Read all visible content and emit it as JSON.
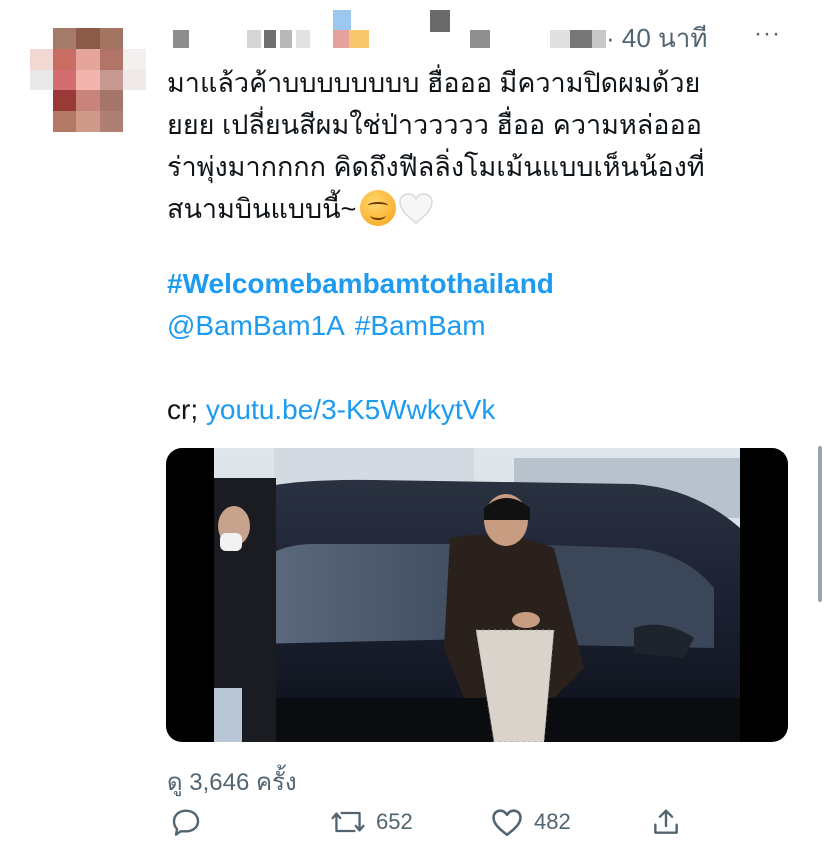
{
  "header": {
    "time": "· 40 นาที",
    "more_icon": "more-icon"
  },
  "tweet": {
    "lines": [
      "มาแล้วค้าบบบบบบบบ ฮื่อออ มีความปิดผมด้วย",
      "ยยย เปลี่ยนสีผมใช่ป่าววววว ฮื่ออ ความหล่อออ",
      "ร่าพุ่งมากกกก คิดถึงฟีลลิ่งโมเม้นแบบเห็นน้องที่"
    ],
    "last_line": "สนามบินแบบนี้~",
    "emojis": [
      "smiling-face-icon",
      "white-heart-icon"
    ],
    "hashtag": "#Welcomebambamtothailand",
    "mention": "@BamBam1A",
    "hashtag2": "#BamBam",
    "cr_prefix": "cr;",
    "cr_link": "youtu.be/3-K5WwkytVk"
  },
  "views": "ดู 3,646 ครั้ง",
  "actions": {
    "reply_icon": "reply-icon",
    "retweet_icon": "retweet-icon",
    "retweet_count": "652",
    "like_icon": "heart-icon",
    "like_count": "482",
    "share_icon": "share-icon"
  },
  "colors": {
    "link": "#1d9bf0",
    "muted": "#536471",
    "text": "#0f1419"
  }
}
